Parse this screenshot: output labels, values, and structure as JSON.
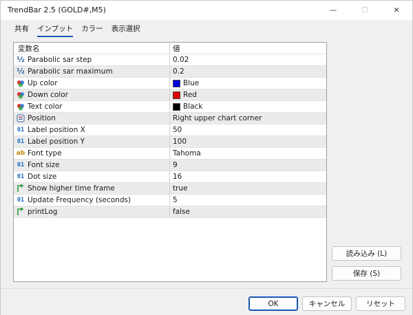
{
  "window": {
    "title": "TrendBar 2.5 (GOLD#,M5)",
    "minimize_glyph": "—",
    "maximize_glyph": "☐",
    "close_glyph": "✕"
  },
  "tabs": [
    {
      "label": "共有"
    },
    {
      "label": "インプット"
    },
    {
      "label": "カラー"
    },
    {
      "label": "表示選択"
    }
  ],
  "active_tab": "インプット",
  "grid": {
    "header": {
      "name": "変数名",
      "value": "値"
    },
    "rows": [
      {
        "icon": "half-fraction-icon",
        "name": "Parabolic sar step",
        "value": "0.02"
      },
      {
        "icon": "half-fraction-icon",
        "name": "Parabolic sar maximum",
        "value": "0.2"
      },
      {
        "icon": "color-palette-icon",
        "name": "Up color",
        "value": "Blue",
        "swatch": "#0000e0"
      },
      {
        "icon": "color-palette-icon",
        "name": "Down color",
        "value": "Red",
        "swatch": "#e00000"
      },
      {
        "icon": "color-palette-icon",
        "name": "Text color",
        "value": "Black",
        "swatch": "#000000"
      },
      {
        "icon": "enum-list-icon",
        "name": "Position",
        "value": "Right upper chart corner"
      },
      {
        "icon": "integer-icon",
        "name": "Label position X",
        "value": "50"
      },
      {
        "icon": "integer-icon",
        "name": "Label position Y",
        "value": "100"
      },
      {
        "icon": "string-ab-icon",
        "name": "Font type",
        "value": "Tahoma"
      },
      {
        "icon": "integer-icon",
        "name": "Font size",
        "value": "9"
      },
      {
        "icon": "integer-icon",
        "name": "Dot size",
        "value": "16"
      },
      {
        "icon": "boolean-arrow-icon",
        "name": "Show higher time frame",
        "value": "true"
      },
      {
        "icon": "integer-icon",
        "name": "Update Frequency (seconds)",
        "value": "5"
      },
      {
        "icon": "boolean-arrow-icon",
        "name": "printLog",
        "value": "false"
      }
    ]
  },
  "side_buttons": {
    "load": "読み込み (L)",
    "save": "保存 (S)"
  },
  "footer_buttons": {
    "ok": "OK",
    "cancel": "キャンセル",
    "reset": "リセット"
  },
  "colors": {
    "accent": "#1a56b4",
    "row_alt": "#ebebeb"
  }
}
